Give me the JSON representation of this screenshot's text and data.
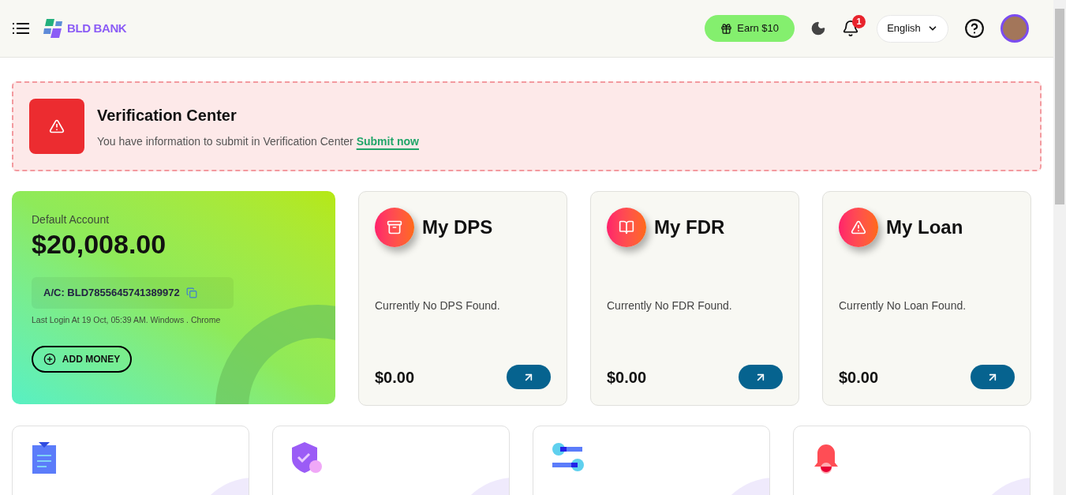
{
  "header": {
    "logo_text": "BLD BANK",
    "earn_button": "Earn $10",
    "notification_count": "1",
    "language": "English"
  },
  "verification": {
    "title": "Verification Center",
    "message": "You have information to submit in Verification Center",
    "link": "Submit now"
  },
  "account": {
    "label": "Default Account",
    "balance": "$20,008.00",
    "account_number": "A/C: BLD7855645741389972",
    "last_login": "Last Login At 19 Oct, 05:39 AM. Windows . Chrome",
    "add_money": "ADD MONEY"
  },
  "summary_cards": [
    {
      "kind": "archive",
      "title": "My DPS",
      "message": "Currently No DPS Found.",
      "amount": "$0.00"
    },
    {
      "kind": "book",
      "title": "My FDR",
      "message": "Currently No FDR Found.",
      "amount": "$0.00"
    },
    {
      "kind": "alert",
      "title": "My Loan",
      "message": "Currently No Loan Found.",
      "amount": "$0.00"
    }
  ],
  "feature_cards": [
    {
      "kind": "clipboard"
    },
    {
      "kind": "shield"
    },
    {
      "kind": "sliders"
    },
    {
      "kind": "bell"
    }
  ]
}
